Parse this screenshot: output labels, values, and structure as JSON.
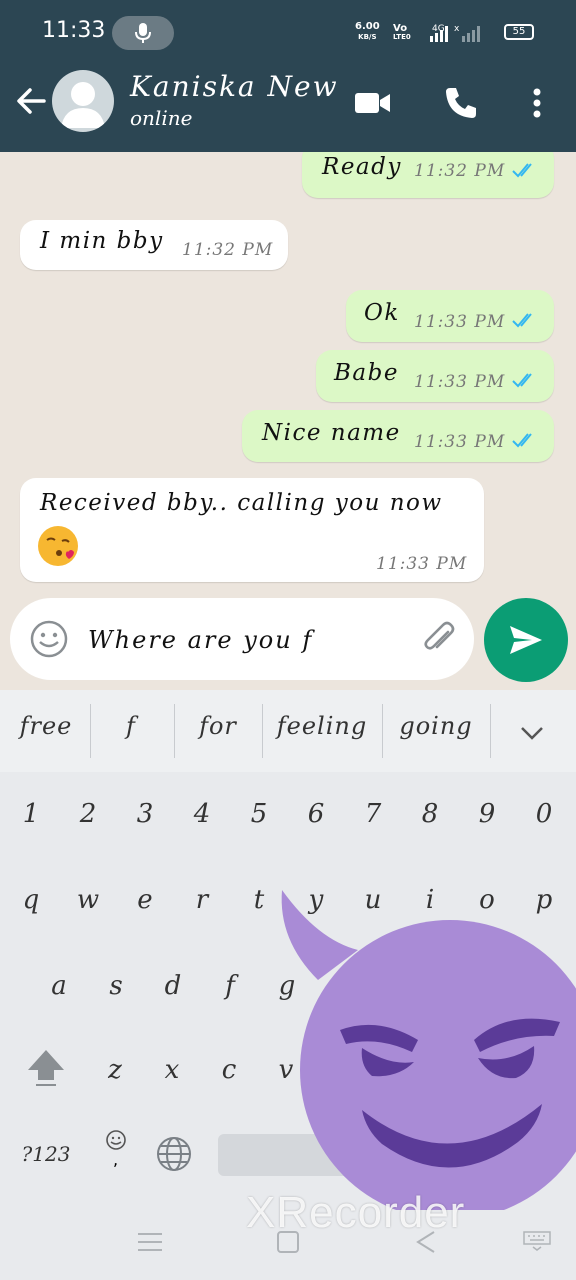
{
  "status_bar": {
    "time": "11:33",
    "net_speed": "6.00",
    "net_unit": "KB/S",
    "volte_top": "Vo",
    "volte_bottom": "LTE0",
    "network": "4G",
    "battery": "55"
  },
  "header": {
    "contact_name": "Kaniska New",
    "contact_status": "online"
  },
  "messages": [
    {
      "direction": "outgoing",
      "text": "Ready",
      "time": "11:32 PM",
      "read": true
    },
    {
      "direction": "incoming",
      "text": "I min bby",
      "time": "11:32 PM"
    },
    {
      "direction": "outgoing",
      "text": "Ok",
      "time": "11:33 PM",
      "read": true
    },
    {
      "direction": "outgoing",
      "text": "Babe",
      "time": "11:33 PM",
      "read": true
    },
    {
      "direction": "outgoing",
      "text": "Nice name",
      "time": "11:33 PM",
      "read": true
    },
    {
      "direction": "incoming",
      "text": "Received bby.. calling you now",
      "emoji": "kissing-face-with-heart",
      "time": "11:33 PM"
    }
  ],
  "composer": {
    "value": "Where are you f"
  },
  "keyboard": {
    "suggestions": [
      "free",
      "f",
      "for",
      "feeling",
      "going"
    ],
    "number_row": [
      "1",
      "2",
      "3",
      "4",
      "5",
      "6",
      "7",
      "8",
      "9",
      "0"
    ],
    "row1": [
      "q",
      "w",
      "e",
      "r",
      "t",
      "y",
      "u",
      "i",
      "o",
      "p"
    ],
    "row2": [
      "a",
      "s",
      "d",
      "f",
      "g"
    ],
    "row3": [
      "z",
      "x",
      "c",
      "v"
    ],
    "symbols_key": "?123",
    "emoji_key_sub": ","
  },
  "watermark": "XRecorder",
  "colors": {
    "header_bg": "#2c4653",
    "chat_bg": "#ece5dd",
    "outgoing_bubble": "#dcf8c6",
    "incoming_bubble": "#ffffff",
    "send_button": "#0b9d74",
    "read_ticks": "#34b7f1",
    "devil_purple": "#a98bd6"
  }
}
